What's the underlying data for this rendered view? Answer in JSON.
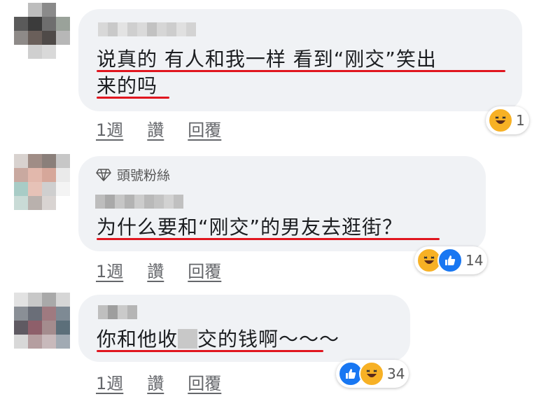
{
  "comments": [
    {
      "text_line1": "说真的 有人和我一样 看到“刚交”笑出",
      "text_line2": "来的吗",
      "reaction_count": "1",
      "reactions": [
        "haha-icon"
      ]
    },
    {
      "badge": "頭號粉絲",
      "text_line1": "为什么要和“刚交”的男友去逛街？",
      "reaction_count": "14",
      "reactions": [
        "haha-icon",
        "like-icon"
      ]
    },
    {
      "text_part1": "你和他收",
      "text_part2": "交的钱啊～～～",
      "reaction_count": "34",
      "reactions": [
        "like-icon",
        "haha-icon"
      ]
    }
  ],
  "actions": {
    "time": "1週",
    "like": "讚",
    "reply": "回覆"
  },
  "colors": {
    "underline": "#e0161f",
    "bubble": "#f0f2f5",
    "like": "#1877f2",
    "haha": "#f7b125"
  }
}
